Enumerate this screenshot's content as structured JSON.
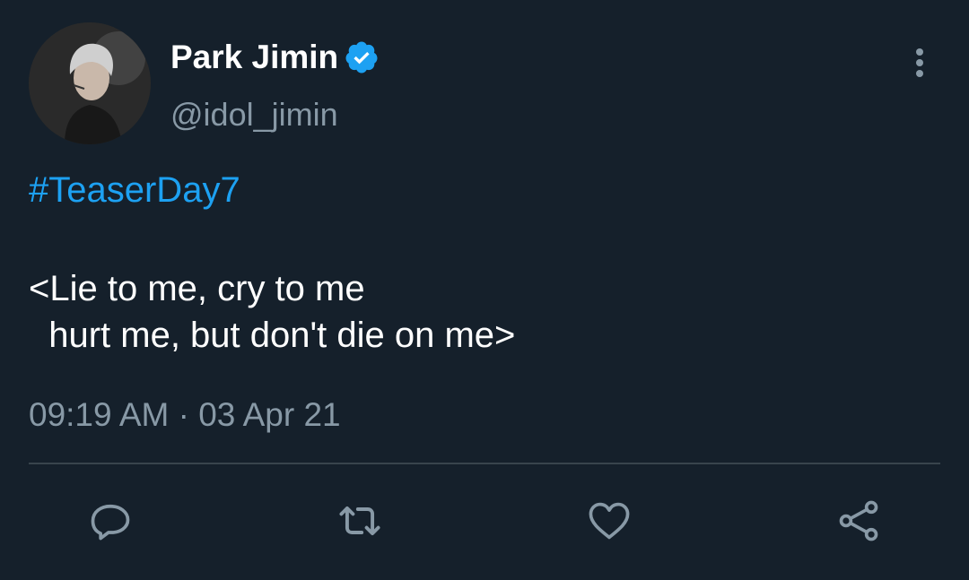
{
  "tweet": {
    "display_name": "Park Jimin",
    "handle": "@idol_jimin",
    "verified": true,
    "hashtag": "#TeaserDay7",
    "text_lines": [
      "<Lie to me, cry to me",
      "  hurt me, but don't die on me>"
    ],
    "timestamp": "09:19 AM · 03 Apr 21"
  },
  "icons": {
    "avatar": "avatar",
    "verified": "verified-badge-icon",
    "more": "more-vertical-icon",
    "reply": "reply-icon",
    "retweet": "retweet-icon",
    "like": "heart-icon",
    "share": "share-icon"
  },
  "colors": {
    "background": "#15202b",
    "primary_text": "#ffffff",
    "secondary_text": "#8899a6",
    "accent": "#1da1f2",
    "divider": "#38444d"
  }
}
